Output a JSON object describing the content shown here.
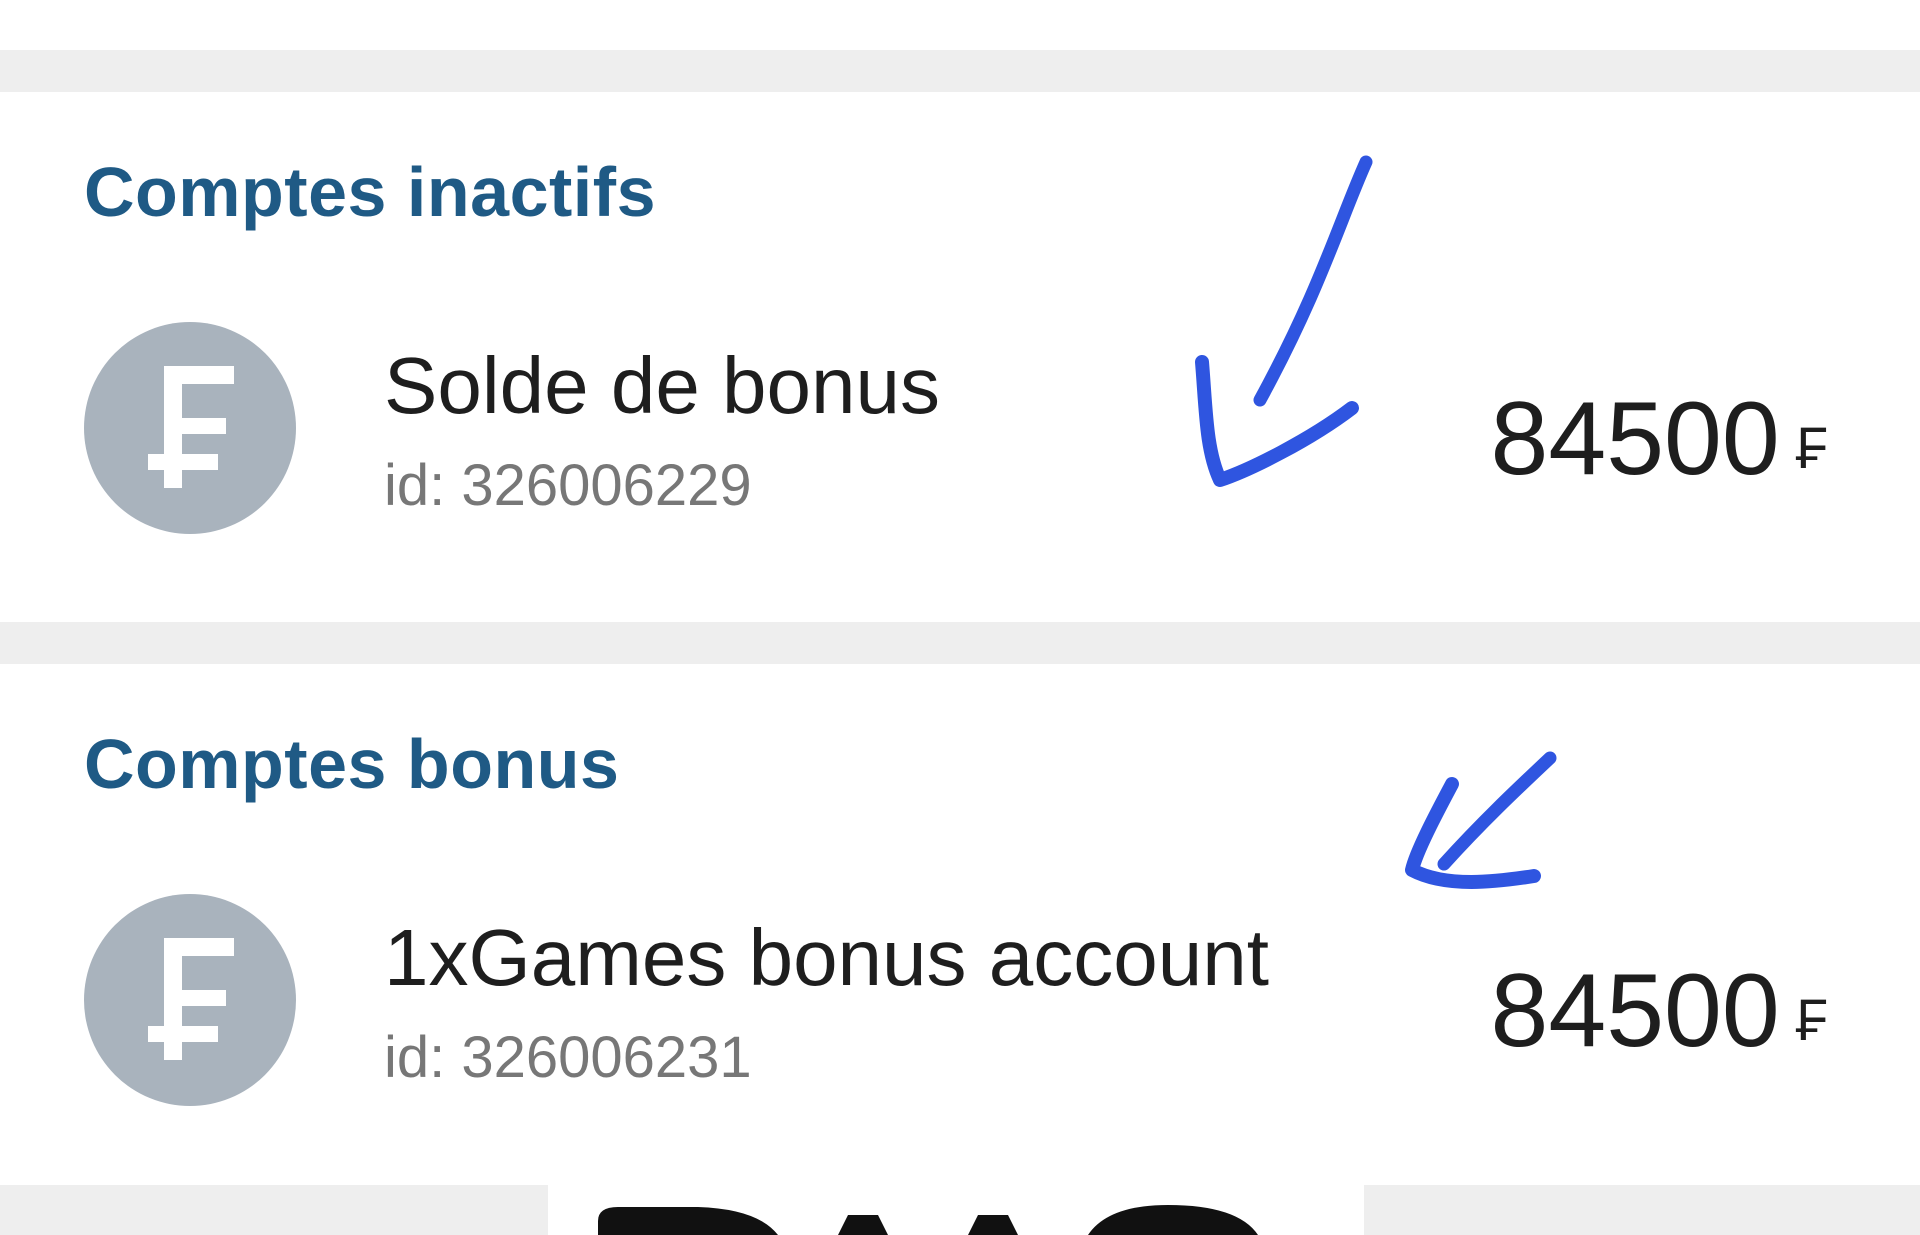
{
  "sections": [
    {
      "title": "Comptes inactifs",
      "account": {
        "name": "Solde de bonus",
        "id": "id: 326006229",
        "balance": "84500",
        "currency": "₣"
      }
    },
    {
      "title": "Comptes bonus",
      "account": {
        "name": "1xGames bonus account",
        "id": "id: 326006231",
        "balance": "84500",
        "currency": "₣"
      }
    }
  ],
  "icons": {
    "account_avatar": "franc-sign-icon",
    "annotation": "hand-drawn-arrow-icon"
  },
  "colors": {
    "section_title": "#1f5a85",
    "avatar_background": "#a9b3bd",
    "divider": "#eeeeee",
    "annotation_stroke": "#2f55e0"
  }
}
